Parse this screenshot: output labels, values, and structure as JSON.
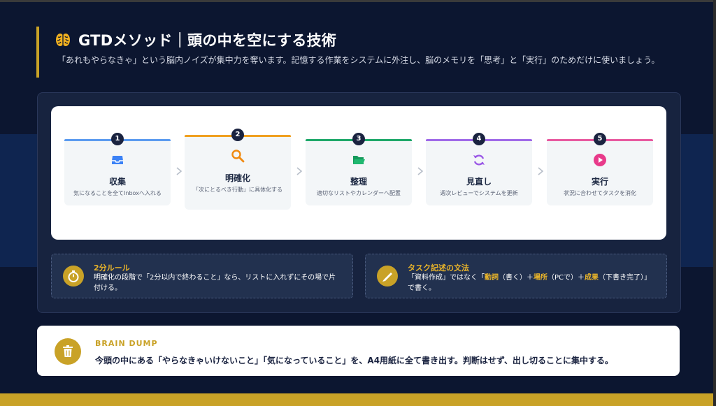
{
  "header": {
    "title": "GTDメソッド｜頭の中を空にする技術",
    "subtitle": "「あれもやらなきゃ」という脳内ノイズが集中力を奪います。記憶する作業をシステムに外注し、脳のメモリを「思考」と「実行」のためだけに使いましょう。"
  },
  "steps": [
    {
      "num": "1",
      "label": "収集",
      "desc": "気になることを全てInboxへ入れる",
      "color": "#5b9bf0",
      "icon": "inbox-icon"
    },
    {
      "num": "2",
      "label": "明確化",
      "desc": "「次にとるべき行動」に具体化する",
      "color": "#f0a020",
      "icon": "magnifier-icon"
    },
    {
      "num": "3",
      "label": "整理",
      "desc": "適切なリストやカレンダーへ配置",
      "color": "#1fa86a",
      "icon": "folder-icon"
    },
    {
      "num": "4",
      "label": "見直し",
      "desc": "週次レビューでシステムを更新",
      "color": "#a06ae8",
      "icon": "refresh-icon"
    },
    {
      "num": "5",
      "label": "実行",
      "desc": "状況に合わせてタスクを消化",
      "color": "#e85aa0",
      "icon": "play-icon"
    }
  ],
  "tips": {
    "two_minute": {
      "title": "2分ルール",
      "text": "明確化の段階で「2分以内で終わること」なら、リストに入れずにその場で片付ける。",
      "icon": "stopwatch-icon"
    },
    "grammar": {
      "title": "タスク記述の文法",
      "text_1": "「資料作成」ではなく「",
      "verb": "動詞",
      "text_2": "（書く）＋",
      "place": "場所",
      "text_3": "（PCで）＋",
      "result": "成果",
      "text_4": "（下書き完了）」で書く。",
      "icon": "pen-icon"
    }
  },
  "brain_dump": {
    "title": "BRAIN DUMP",
    "text": "今頭の中にある「やらなきゃいけないこと」「気になっていること」を、A4用紙に全て書き出す。判断はせず、出し切ることに集中する。",
    "icon": "trash-icon"
  },
  "colors": {
    "accent": "#c9a227",
    "background": "#0c1630",
    "highlight": "#e9b42a"
  }
}
